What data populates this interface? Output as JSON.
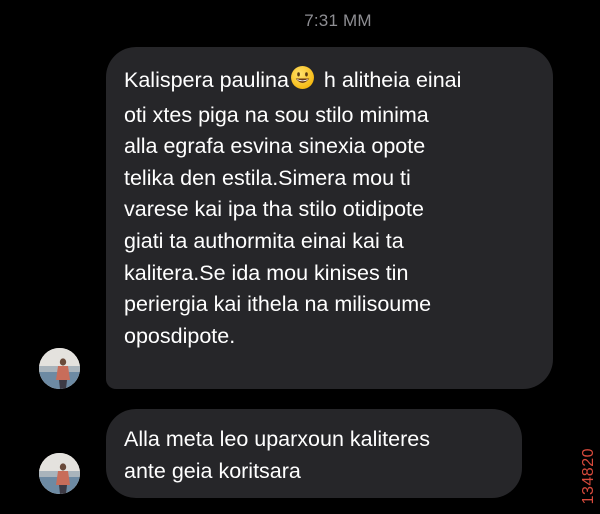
{
  "header": {
    "timestamp": "7:31 MM"
  },
  "messages": [
    {
      "sender": "incoming",
      "avatar_icon": "avatar-photo",
      "lines": [
        {
          "before_emoji": "Kalispera paulina",
          "emoji": "grinning-face-icon",
          "after_emoji": " h alitheia einai"
        },
        "oti xtes piga na sou stilo minima",
        "alla egrafa esvina sinexia opote",
        "telika den estila.Simera mou ti",
        "varese kai ipa tha stilo otidipote",
        "giati ta authormita einai kai ta",
        "kalitera.Se ida mou kinises tin",
        "periergia kai ithela na milisoume",
        "oposdipote."
      ]
    },
    {
      "sender": "incoming",
      "avatar_icon": "avatar-photo",
      "lines": [
        "Alla meta leo uparxoun kaliteres",
        "ante geia koritsara"
      ]
    }
  ],
  "watermark": "134820",
  "colors": {
    "background": "#000000",
    "bubble": "#262629",
    "timestamp": "#8e8e93",
    "watermark": "#d84a3c"
  }
}
